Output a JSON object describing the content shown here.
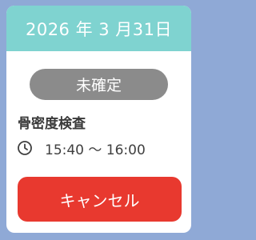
{
  "card": {
    "date": "2026 年 3 月31日",
    "status": "未確定",
    "exam_name": "骨密度検査",
    "time": "15:40 〜 16:00",
    "cancel_label": "キャンセル",
    "icons": {
      "time": "clock-icon"
    },
    "colors": {
      "background": "#8fa9d6",
      "header": "#7fd3d0",
      "status_pill": "#8b8b8b",
      "cancel_button": "#e8392f"
    }
  }
}
